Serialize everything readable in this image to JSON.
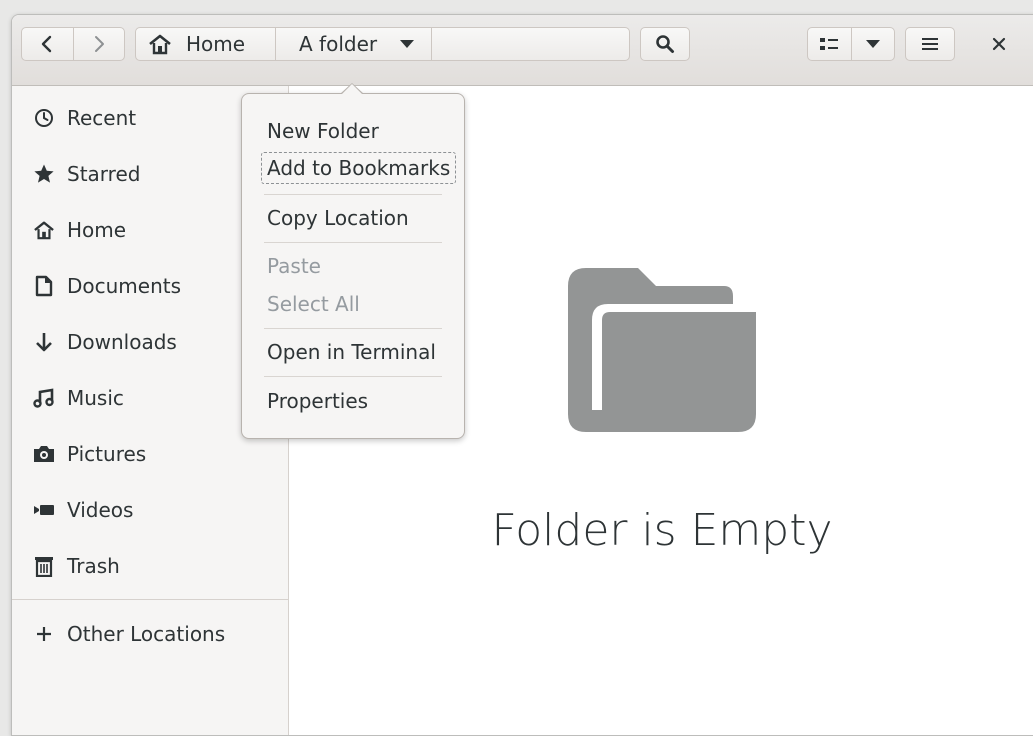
{
  "headerbar": {
    "back_icon": "chevron-left-icon",
    "forward_icon": "chevron-right-icon",
    "pathbar": {
      "home_icon": "home-icon",
      "home_label": "Home",
      "folder_label": "A folder",
      "folder_dropdown_icon": "triangle-down-icon"
    },
    "search_icon": "search-icon",
    "view_icon": "list-view-icon",
    "view_dropdown_icon": "triangle-down-icon",
    "menu_icon": "hamburger-icon",
    "close_icon": "close-icon"
  },
  "sidebar": {
    "items": [
      {
        "label": "Recent",
        "icon": "clock-icon"
      },
      {
        "label": "Starred",
        "icon": "star-icon"
      },
      {
        "label": "Home",
        "icon": "home-icon"
      },
      {
        "label": "Documents",
        "icon": "document-icon"
      },
      {
        "label": "Downloads",
        "icon": "arrow-down-icon"
      },
      {
        "label": "Music",
        "icon": "music-note-icon"
      },
      {
        "label": "Pictures",
        "icon": "camera-icon"
      },
      {
        "label": "Videos",
        "icon": "video-camera-icon"
      },
      {
        "label": "Trash",
        "icon": "trash-icon"
      }
    ],
    "other_locations": {
      "label": "Other Locations",
      "icon": "plus-icon"
    }
  },
  "context_menu": {
    "new_folder": "New Folder",
    "add_to_bookmarks": "Add to Bookmarks",
    "copy_location": "Copy Location",
    "paste": "Paste",
    "select_all": "Select All",
    "open_in_terminal": "Open in Terminal",
    "properties": "Properties"
  },
  "main": {
    "empty_icon": "folder-icon",
    "empty_text": "Folder is Empty",
    "folder_icon_color": "#939595"
  }
}
